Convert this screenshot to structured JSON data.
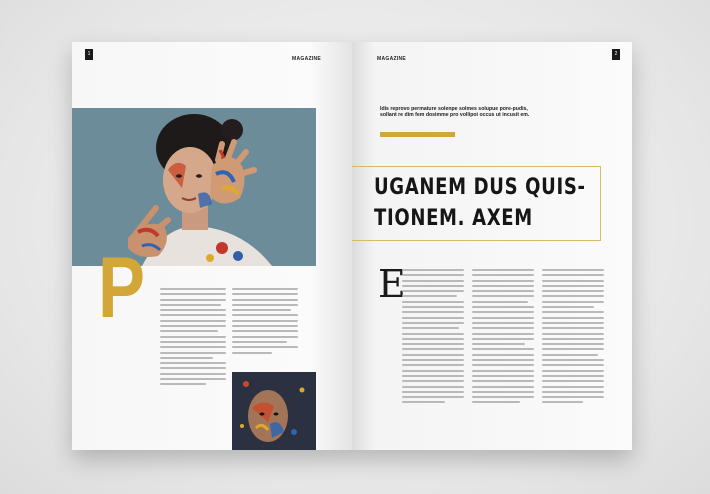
{
  "left_page": {
    "page_number": "1",
    "running_head": "MAGAZINE",
    "drop_cap": "P"
  },
  "right_page": {
    "page_number": "2",
    "running_head": "MAGAZINE",
    "intro": "Idis reprovo permature solenpe solmes solupue pore-pudis, sollant re dim fem dosimme pro vollipoi occus ut incusit em.",
    "headline_line1": "UGANEM DUS QUIS-",
    "headline_line2": "TIONEM. AXEM",
    "drop_cap": "E"
  },
  "colors": {
    "accent": "#d2a637",
    "text": "#161616",
    "photo_bg": "#6d8c99"
  }
}
